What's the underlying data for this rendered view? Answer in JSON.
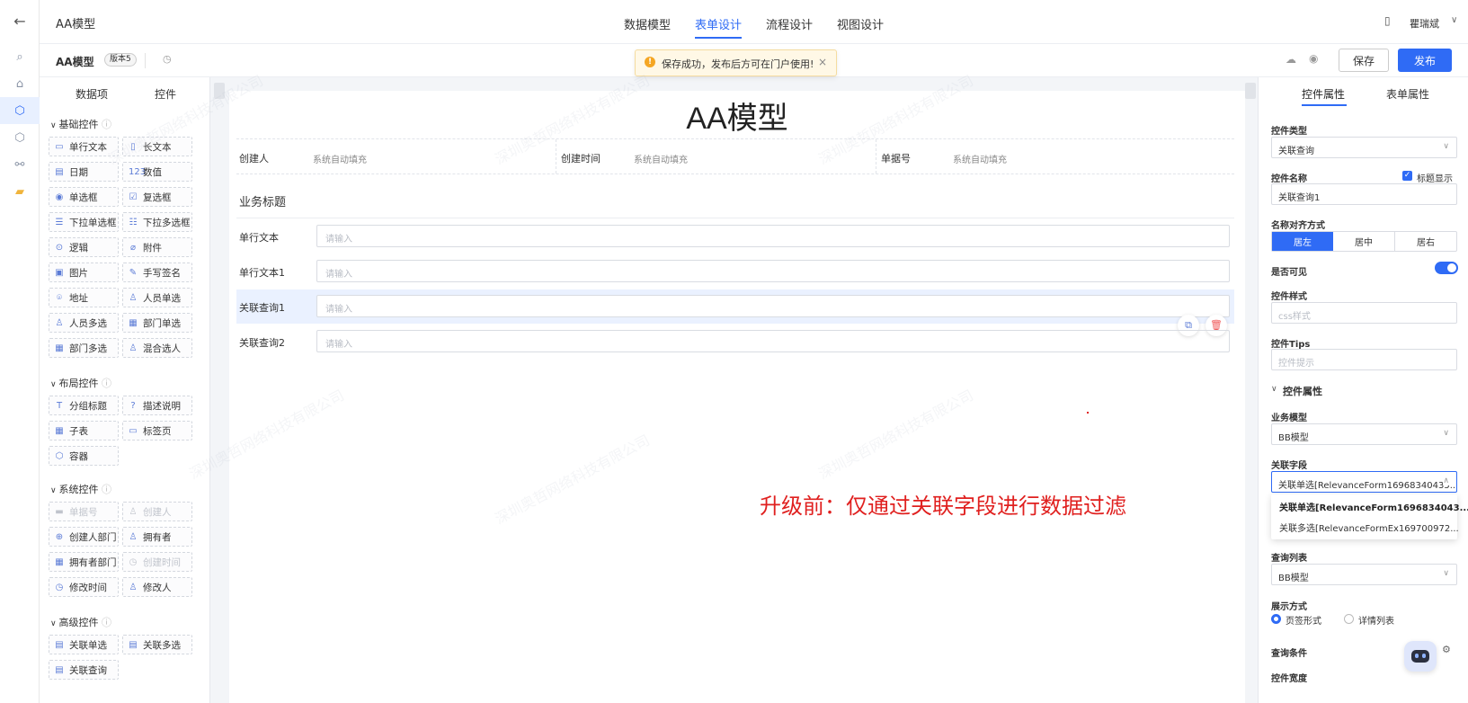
{
  "header": {
    "app_title": "AA模型",
    "tabs": [
      {
        "label": "数据模型",
        "active": false
      },
      {
        "label": "表单设计",
        "active": true
      },
      {
        "label": "流程设计",
        "active": false
      },
      {
        "label": "视图设计",
        "active": false
      }
    ],
    "user_name": "瞿瑞斌"
  },
  "subbar": {
    "model_name": "AA模型",
    "version_badge": "版本5",
    "save_label": "保存",
    "publish_label": "发布"
  },
  "toast": {
    "message": "保存成功，发布后方可在门户使用!",
    "close": "×"
  },
  "left_panel": {
    "tabs": [
      {
        "label": "数据项",
        "active": false
      },
      {
        "label": "控件",
        "active": true
      }
    ],
    "groups": [
      {
        "title": "基础控件",
        "items": [
          {
            "label": "单行文本",
            "icon": "▭"
          },
          {
            "label": "长文本",
            "icon": "▯"
          },
          {
            "label": "日期",
            "icon": "▤"
          },
          {
            "label": "数值",
            "icon": "123"
          },
          {
            "label": "单选框",
            "icon": "◉"
          },
          {
            "label": "复选框",
            "icon": "☑"
          },
          {
            "label": "下拉单选框",
            "icon": "☰"
          },
          {
            "label": "下拉多选框",
            "icon": "☷"
          },
          {
            "label": "逻辑",
            "icon": "⊙"
          },
          {
            "label": "附件",
            "icon": "⌀"
          },
          {
            "label": "图片",
            "icon": "▣"
          },
          {
            "label": "手写签名",
            "icon": "✎"
          },
          {
            "label": "地址",
            "icon": "⌾"
          },
          {
            "label": "人员单选",
            "icon": "♙"
          },
          {
            "label": "人员多选",
            "icon": "♙"
          },
          {
            "label": "部门单选",
            "icon": "▦"
          },
          {
            "label": "部门多选",
            "icon": "▦"
          },
          {
            "label": "混合选人",
            "icon": "♙"
          }
        ]
      },
      {
        "title": "布局控件",
        "items": [
          {
            "label": "分组标题",
            "icon": "T"
          },
          {
            "label": "描述说明",
            "icon": "?"
          },
          {
            "label": "子表",
            "icon": "▦"
          },
          {
            "label": "标签页",
            "icon": "▭"
          },
          {
            "label": "容器",
            "icon": "⬡"
          }
        ]
      },
      {
        "title": "系统控件",
        "items": [
          {
            "label": "单据号",
            "icon": "▬",
            "disabled": true
          },
          {
            "label": "创建人",
            "icon": "♙",
            "disabled": true
          },
          {
            "label": "创建人部门",
            "icon": "⊕"
          },
          {
            "label": "拥有者",
            "icon": "♙"
          },
          {
            "label": "拥有者部门",
            "icon": "▦"
          },
          {
            "label": "创建时间",
            "icon": "◷",
            "disabled": true
          },
          {
            "label": "修改时间",
            "icon": "◷"
          },
          {
            "label": "修改人",
            "icon": "♙"
          }
        ]
      },
      {
        "title": "高级控件",
        "items": [
          {
            "label": "关联单选",
            "icon": "▤"
          },
          {
            "label": "关联多选",
            "icon": "▤"
          },
          {
            "label": "关联查询",
            "icon": "▤"
          }
        ]
      }
    ]
  },
  "form": {
    "title": "AA模型",
    "system_fields": [
      {
        "label": "创建人",
        "value": "系统自动填充"
      },
      {
        "label": "创建时间",
        "value": "系统自动填充"
      },
      {
        "label": "单据号",
        "value": "系统自动填充"
      }
    ],
    "section_title": "业务标题",
    "fields": [
      {
        "label": "单行文本",
        "placeholder": "请输入",
        "selected": false
      },
      {
        "label": "单行文本1",
        "placeholder": "请输入",
        "selected": false
      },
      {
        "label": "关联查询1",
        "placeholder": "请输入",
        "selected": true
      },
      {
        "label": "关联查询2",
        "placeholder": "请输入",
        "selected": false
      }
    ],
    "annotation": "升级前：仅通过关联字段进行数据过滤"
  },
  "right_panel": {
    "tabs": [
      {
        "label": "控件属性",
        "active": true
      },
      {
        "label": "表单属性",
        "active": false
      }
    ],
    "control_type_label": "控件类型",
    "control_type_value": "关联查询",
    "control_name_label": "控件名称",
    "title_display_label": "标题显示",
    "title_display_checked": true,
    "control_name_value": "关联查询1",
    "align_label": "名称对齐方式",
    "align_options": [
      "居左",
      "居中",
      "居右"
    ],
    "align_selected": "居左",
    "visible_label": "是否可见",
    "visible_on": true,
    "style_label": "控件样式",
    "style_placeholder": "css样式",
    "tips_label": "控件Tips",
    "tips_placeholder": "控件提示",
    "props_section": "控件属性",
    "biz_model_label": "业务模型",
    "biz_model_value": "BB模型",
    "rel_field_label": "关联字段",
    "rel_field_value": "关联单选[RelevanceForm16968340435...",
    "rel_field_options": [
      "关联单选[RelevanceForm1696834043...",
      "关联多选[RelevanceFormEx169700972..."
    ],
    "query_list_label": "查询列表",
    "query_list_value": "BB模型",
    "display_mode_label": "展示方式",
    "display_modes": [
      {
        "label": "页签形式",
        "checked": true
      },
      {
        "label": "详情列表",
        "checked": false
      }
    ],
    "query_cond_label": "查询条件",
    "width_label": "控件宽度"
  },
  "colors": {
    "accent": "#2f6bf5",
    "annotation": "#e0201f",
    "delete": "#f05a5a"
  }
}
